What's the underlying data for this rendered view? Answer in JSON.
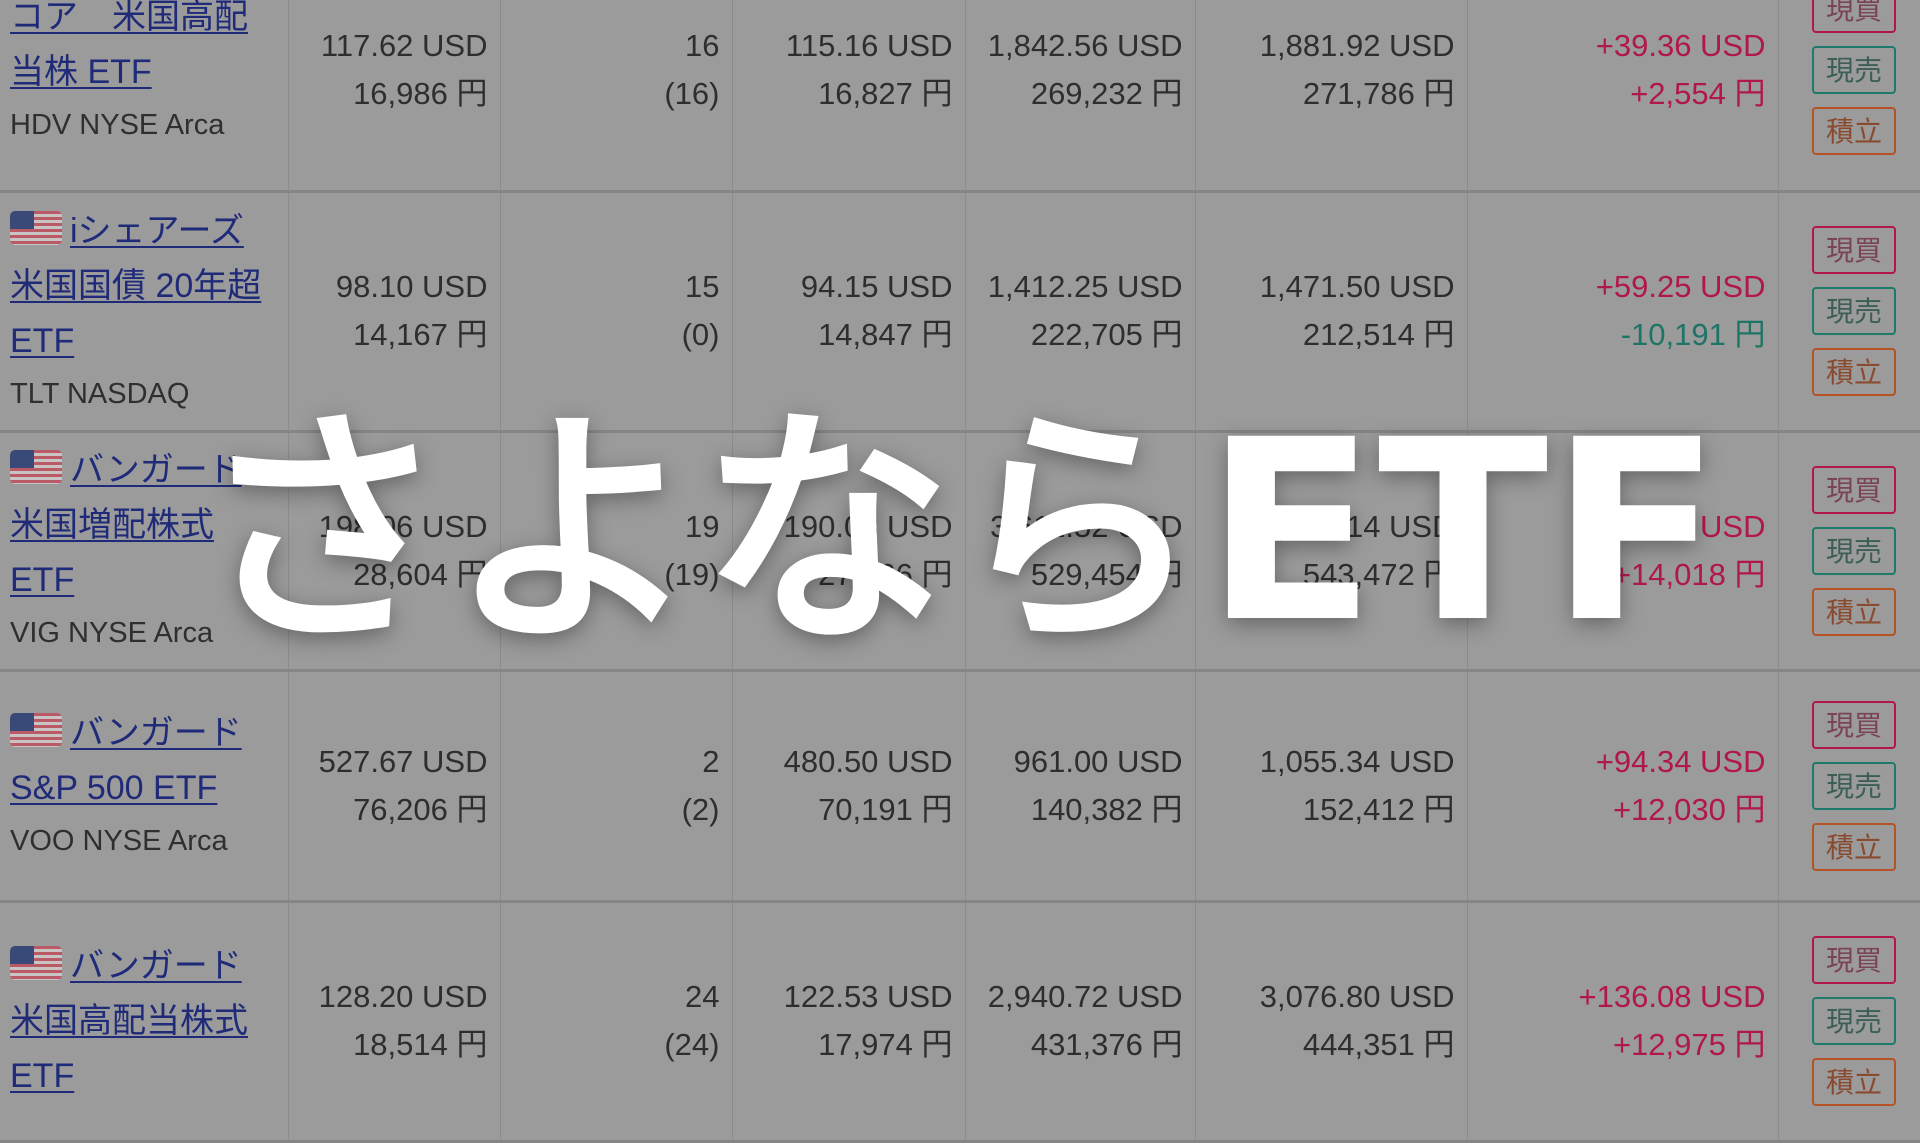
{
  "overlay": {
    "title": "さよならETF"
  },
  "colors": {
    "gain": "#b0184a",
    "loss": "#1e7566",
    "link": "#1f2a78",
    "buy": "#b1164c",
    "sell": "#1e7a6a",
    "accumulate": "#b55226"
  },
  "actions": {
    "buy": "現買",
    "sell": "現売",
    "accumulate": "積立"
  },
  "rows": [
    {
      "flag": "us-flag-icon",
      "name": "iシェアーズ・コア　米国高配当株 ETF",
      "name_visible": "コア　米国高配当株 ETF",
      "ticker": "HDV NYSE Arca",
      "price_usd": "117.62 USD",
      "price_jpy": "16,986 円",
      "qty": "16",
      "qty_sub": "(16)",
      "avg_usd": "115.16 USD",
      "avg_jpy": "16,827 円",
      "cost_usd": "1,842.56 USD",
      "cost_jpy": "269,232 円",
      "value_usd": "1,881.92 USD",
      "value_jpy": "271,786 円",
      "pl_usd": "+39.36 USD",
      "pl_jpy": "+2,554 円",
      "pl_usd_sign": "pos",
      "pl_jpy_sign": "pos"
    },
    {
      "flag": "us-flag-icon",
      "name": "iシェアーズ 米国国債 20年超 ETF",
      "ticker": "TLT NASDAQ",
      "price_usd": "98.10 USD",
      "price_jpy": "14,167 円",
      "qty": "15",
      "qty_sub": "(0)",
      "avg_usd": "94.15 USD",
      "avg_jpy": "14,847 円",
      "cost_usd": "1,412.25 USD",
      "cost_jpy": "222,705 円",
      "value_usd": "1,471.50 USD",
      "value_jpy": "212,514 円",
      "pl_usd": "+59.25 USD",
      "pl_jpy": "-10,191 円",
      "pl_usd_sign": "pos",
      "pl_jpy_sign": "neg"
    },
    {
      "flag": "us-flag-icon",
      "name": "バンガード 米国増配株式ETF",
      "ticker": "VIG NYSE Arca",
      "price_usd": "198.06 USD",
      "price_jpy": "28,604 円",
      "qty": "19",
      "qty_sub": "(19)",
      "avg_usd": "190.08 USD",
      "avg_jpy": "27,866 円",
      "cost_usd": "3,611.52 USD",
      "cost_jpy": "529,454 円",
      "value_usd": "3,763.14 USD",
      "value_jpy": "543,472 円",
      "pl_usd": "+151.62 USD",
      "pl_jpy": "+14,018 円",
      "pl_usd_sign": "pos",
      "pl_jpy_sign": "pos"
    },
    {
      "flag": "us-flag-icon",
      "name": "バンガード S&P 500 ETF",
      "ticker": "VOO NYSE Arca",
      "price_usd": "527.67 USD",
      "price_jpy": "76,206 円",
      "qty": "2",
      "qty_sub": "(2)",
      "avg_usd": "480.50 USD",
      "avg_jpy": "70,191 円",
      "cost_usd": "961.00 USD",
      "cost_jpy": "140,382 円",
      "value_usd": "1,055.34 USD",
      "value_jpy": "152,412 円",
      "pl_usd": "+94.34 USD",
      "pl_jpy": "+12,030 円",
      "pl_usd_sign": "pos",
      "pl_jpy_sign": "pos"
    },
    {
      "flag": "us-flag-icon",
      "name": "バンガード 米国高配当株式ETF",
      "ticker": "",
      "price_usd": "128.20 USD",
      "price_jpy": "18,514 円",
      "qty": "24",
      "qty_sub": "(24)",
      "avg_usd": "122.53 USD",
      "avg_jpy": "17,974 円",
      "cost_usd": "2,940.72 USD",
      "cost_jpy": "431,376 円",
      "value_usd": "3,076.80 USD",
      "value_jpy": "444,351 円",
      "pl_usd": "+136.08 USD",
      "pl_jpy": "+12,975 円",
      "pl_usd_sign": "pos",
      "pl_jpy_sign": "pos"
    }
  ]
}
